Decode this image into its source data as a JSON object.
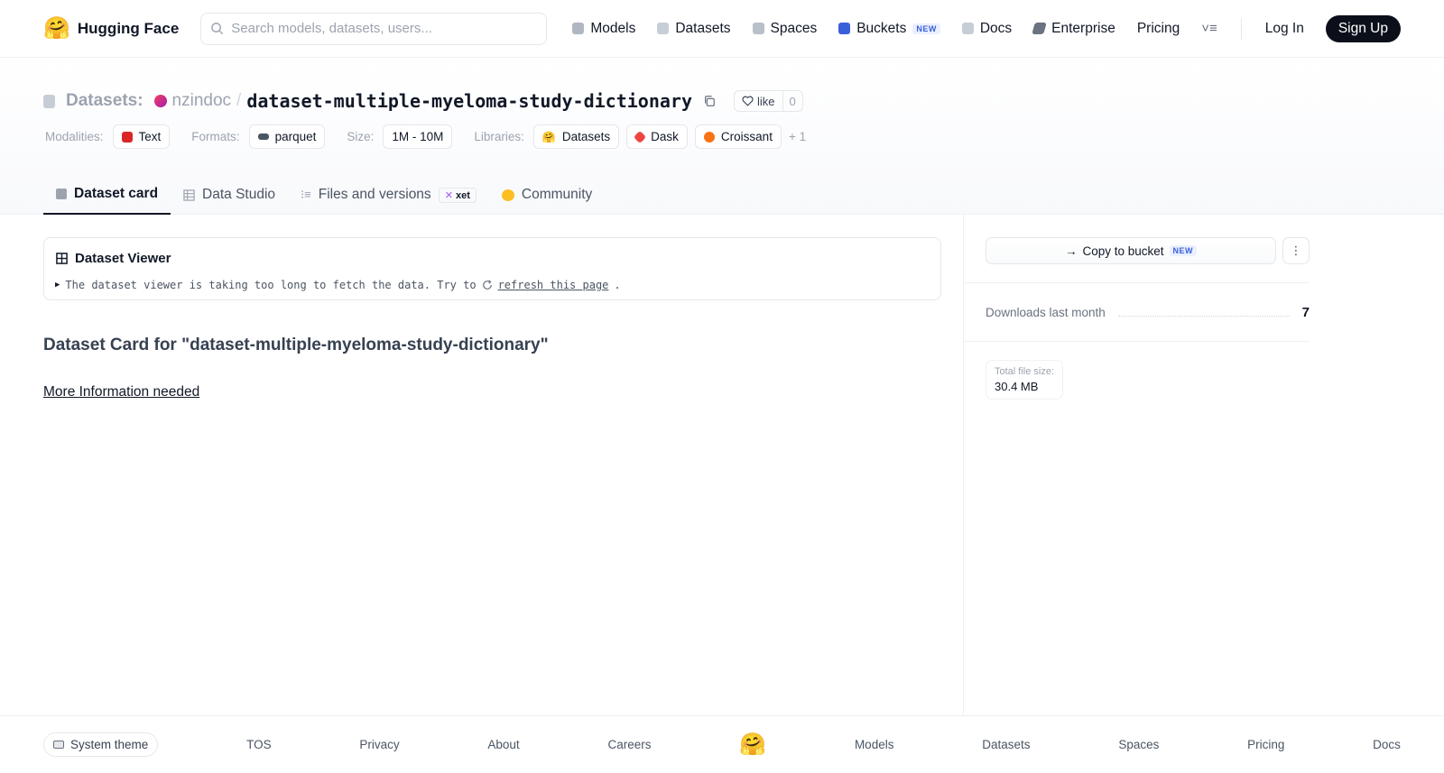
{
  "header": {
    "brand": "Hugging Face",
    "search_placeholder": "Search models, datasets, users...",
    "nav": [
      {
        "label": "Models",
        "icon": "models-cube-icon",
        "color": "#9ca3af"
      },
      {
        "label": "Datasets",
        "icon": "datasets-icon",
        "color": "#c7cdd6"
      },
      {
        "label": "Spaces",
        "icon": "spaces-icon",
        "color": "#b8bfca"
      },
      {
        "label": "Buckets",
        "icon": "buckets-icon",
        "color": "#3b5fd9",
        "badge": "NEW"
      },
      {
        "label": "Docs",
        "icon": "docs-book-icon",
        "color": "#c7cdd6"
      },
      {
        "label": "Enterprise",
        "icon": "enterprise-icon",
        "color": "#6b7280"
      },
      {
        "label": "Pricing"
      }
    ],
    "login": "Log In",
    "signup": "Sign Up"
  },
  "repo": {
    "type_label": "Datasets:",
    "owner": "nzindoc",
    "separator": "/",
    "name": "dataset-multiple-myeloma-study-dictionary",
    "like_label": "like",
    "like_count": "0"
  },
  "tags": {
    "modalities_label": "Modalities:",
    "modalities": [
      "Text"
    ],
    "formats_label": "Formats:",
    "formats": [
      "parquet"
    ],
    "size_label": "Size:",
    "size": "1M - 10M",
    "libraries_label": "Libraries:",
    "libraries": [
      "Datasets",
      "Dask",
      "Croissant"
    ],
    "more": "+ 1"
  },
  "tabs": [
    {
      "label": "Dataset card",
      "active": true
    },
    {
      "label": "Data Studio"
    },
    {
      "label": "Files and versions",
      "badge": "xet"
    },
    {
      "label": "Community"
    }
  ],
  "viewer": {
    "title": "Dataset Viewer",
    "message": "The dataset viewer is taking too long to fetch the data. Try to",
    "link": "refresh this page",
    "trailing": "."
  },
  "card": {
    "title": "Dataset Card for \"dataset-multiple-myeloma-study-dictionary\"",
    "more_info": "More Information needed"
  },
  "sidebar": {
    "copy_bucket": "Copy to bucket",
    "copy_badge": "NEW",
    "downloads_label": "Downloads last month",
    "downloads_value": "7",
    "filesize_label": "Total file size:",
    "filesize_value": "30.4 MB"
  },
  "footer": {
    "theme": "System theme",
    "links": [
      "TOS",
      "Privacy",
      "About",
      "Careers",
      "Models",
      "Datasets",
      "Spaces",
      "Pricing",
      "Docs"
    ]
  },
  "colors": {
    "accent": "#0b0f1a",
    "new_badge": "#3b5fd9"
  }
}
